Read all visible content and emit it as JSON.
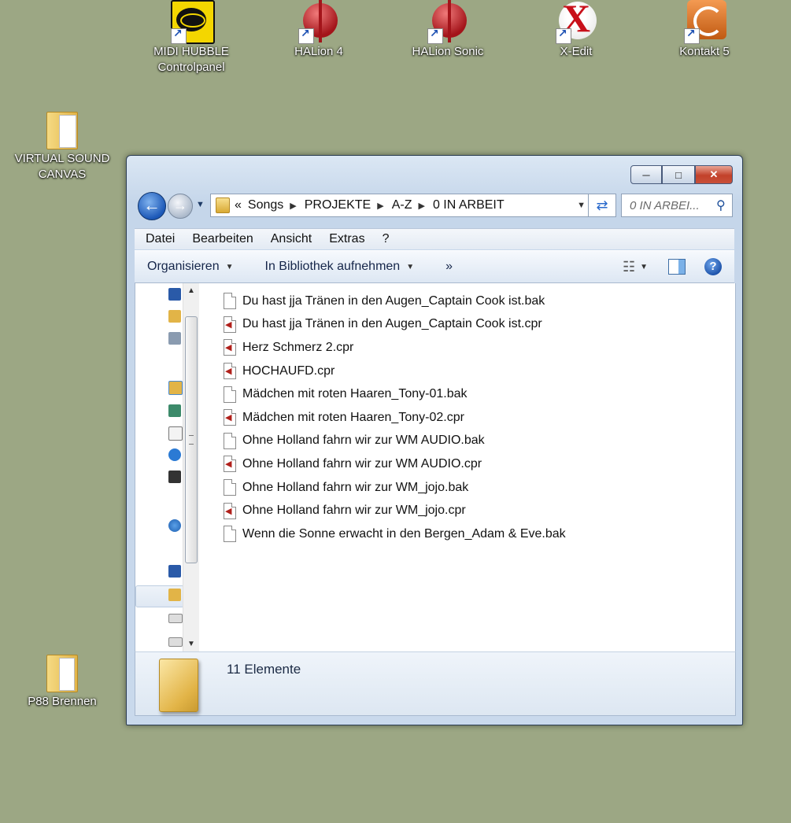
{
  "desktop": {
    "icons": [
      {
        "label1": "MIDI HUBBLE",
        "label2": "Controlpanel"
      },
      {
        "label1": "HALion 4"
      },
      {
        "label1": "HALion Sonic"
      },
      {
        "label1": "X-Edit"
      },
      {
        "label1": "Kontakt 5"
      },
      {
        "label1": "VIRTUAL SOUND",
        "label2": "CANVAS"
      },
      {
        "label1": "P88 Brennen"
      }
    ]
  },
  "window": {
    "address": {
      "prefix": "«",
      "crumbs": [
        "Songs",
        "PROJEKTE",
        "A-Z",
        "0 IN ARBEIT"
      ]
    },
    "search": {
      "placeholder": "0 IN ARBEI..."
    },
    "menu": [
      "Datei",
      "Bearbeiten",
      "Ansicht",
      "Extras",
      "?"
    ],
    "commands": {
      "organize": "Organisieren",
      "library": "In Bibliothek aufnehmen",
      "more": "»"
    },
    "files": [
      {
        "name": "Du hast jja Tränen in den Augen_Captain Cook ist.bak",
        "type": "bak"
      },
      {
        "name": "Du hast jja Tränen in den Augen_Captain Cook ist.cpr",
        "type": "cpr"
      },
      {
        "name": "Herz Schmerz 2.cpr",
        "type": "cpr"
      },
      {
        "name": "HOCHAUFD.cpr",
        "type": "cpr"
      },
      {
        "name": "Mädchen mit roten Haaren_Tony-01.bak",
        "type": "bak"
      },
      {
        "name": "Mädchen mit roten Haaren_Tony-02.cpr",
        "type": "cpr"
      },
      {
        "name": "Ohne Holland fahrn wir zur WM AUDIO.bak",
        "type": "bak"
      },
      {
        "name": "Ohne Holland fahrn wir zur WM AUDIO.cpr",
        "type": "cpr"
      },
      {
        "name": "Ohne Holland fahrn wir zur WM_jojo.bak",
        "type": "bak"
      },
      {
        "name": "Ohne Holland fahrn wir zur WM_jojo.cpr",
        "type": "cpr"
      },
      {
        "name": "Wenn die Sonne erwacht in den Bergen_Adam & Eve.bak",
        "type": "bak"
      }
    ],
    "details": {
      "count": "11 Elemente"
    }
  },
  "colors": {
    "desktop": "#9ca784",
    "cpr_icon": "#b0201b"
  }
}
